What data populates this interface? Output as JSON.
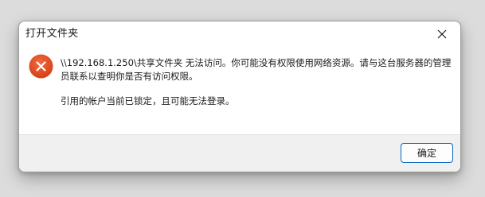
{
  "dialog": {
    "title": "打开文件夹",
    "message_line1": "\\\\192.168.1.250\\共享文件夹 无法访问。你可能没有权限使用网络资源。请与这台服务器的管理员联系以查明你是否有访问权限。",
    "message_line2": "引用的帐户当前已锁定，且可能无法登录。",
    "ok_button_label": "确定",
    "icons": {
      "error": "error-icon",
      "close": "close-icon"
    },
    "colors": {
      "error_red": "#e0481f",
      "accent_border": "#0067c0"
    }
  }
}
